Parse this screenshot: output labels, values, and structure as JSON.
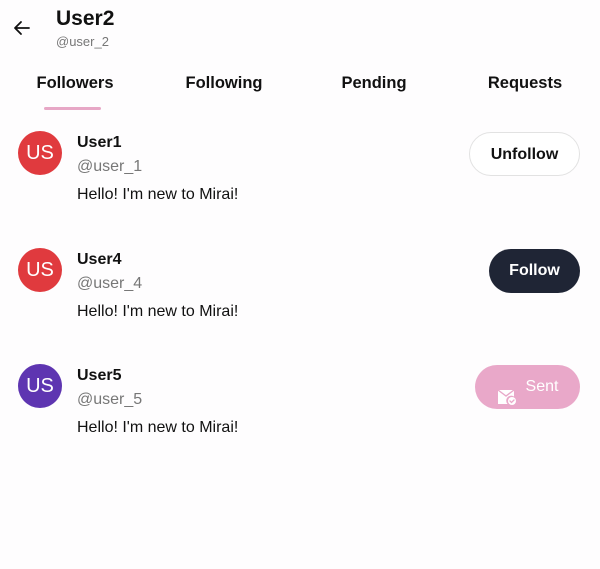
{
  "header": {
    "title": "User2",
    "handle": "@user_2"
  },
  "tabs": [
    {
      "label": "Followers"
    },
    {
      "label": "Following"
    },
    {
      "label": "Pending"
    },
    {
      "label": "Requests"
    }
  ],
  "colors": {
    "active_tab_underline": "#e7a7c6",
    "follow_button": "#1f2535",
    "sent_button": "#e9a8c9"
  },
  "users": [
    {
      "initials": "US",
      "avatar_color": "#e03a3e",
      "name": "User1",
      "handle": "@user_1",
      "bio": "Hello! I'm new to Mirai!",
      "action": "Unfollow"
    },
    {
      "initials": "US",
      "avatar_color": "#e03a3e",
      "name": "User4",
      "handle": "@user_4",
      "bio": "Hello! I'm new to Mirai!",
      "action": "Follow"
    },
    {
      "initials": "US",
      "avatar_color": "#5e35b1",
      "name": "User5",
      "handle": "@user_5",
      "bio": "Hello! I'm new to Mirai!",
      "action": "Sent",
      "action_icon": "mail-check-icon"
    }
  ]
}
